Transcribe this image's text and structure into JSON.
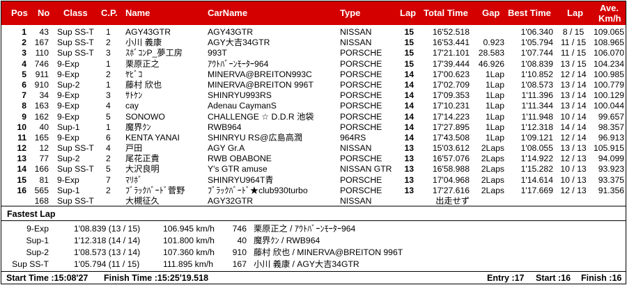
{
  "headers": {
    "pos": "Pos",
    "no": "No",
    "class": "Class",
    "cp": "C.P.",
    "name": "Name",
    "carname": "CarName",
    "type": "Type",
    "lap": "Lap",
    "total_time": "Total Time",
    "gap": "Gap",
    "best_time": "Best Time",
    "best_lap": "Lap",
    "ave_top": "Ave.",
    "ave_bottom": "Km/h"
  },
  "rows": [
    {
      "pos": "1",
      "no": "43",
      "class": "Sup SS-T",
      "cp": "1",
      "name": "AGY43GTR",
      "car": "AGY43GTR",
      "type": "NISSAN",
      "lap": "15",
      "total": "16'52.518",
      "gap": "",
      "best": "1'06.340",
      "blap": "8 / 15",
      "ave": "109.065"
    },
    {
      "pos": "2",
      "no": "167",
      "class": "Sup SS-T",
      "cp": "2",
      "name": "小川 義康",
      "car": "AGY大吉34GTR",
      "type": "NISSAN",
      "lap": "15",
      "total": "16'53.441",
      "gap": "0.923",
      "best": "1'05.794",
      "blap": "11 / 15",
      "ave": "108.965"
    },
    {
      "pos": "3",
      "no": "110",
      "class": "Sup SS-T",
      "cp": "3",
      "name": "ｽﾎﾞｺﾝP_夢工房",
      "car": "993T",
      "type": "PORSCHE",
      "lap": "15",
      "total": "17'21.101",
      "gap": "28.583",
      "best": "1'07.744",
      "blap": "11 / 15",
      "ave": "106.070"
    },
    {
      "pos": "4",
      "no": "746",
      "class": "9-Exp",
      "cp": "1",
      "name": "栗原正之",
      "car": "ｱｳﾄﾊﾞｰﾝﾓｰﾀｰ964",
      "type": "PORSCHE",
      "lap": "15",
      "total": "17'39.444",
      "gap": "46.926",
      "best": "1'08.839",
      "blap": "13 / 15",
      "ave": "104.234"
    },
    {
      "pos": "5",
      "no": "911",
      "class": "9-Exp",
      "cp": "2",
      "name": "ﾔﾋﾞｺ",
      "car": "MINERVA@BREITON993C",
      "type": "PORSCHE",
      "lap": "14",
      "total": "17'00.623",
      "gap": "1Lap",
      "best": "1'10.852",
      "blap": "12 / 14",
      "ave": "100.985"
    },
    {
      "pos": "6",
      "no": "910",
      "class": "Sup-2",
      "cp": "1",
      "name": "藤村 欣也",
      "car": "MINERVA@BREITON 996T",
      "type": "PORSCHE",
      "lap": "14",
      "total": "17'02.709",
      "gap": "1Lap",
      "best": "1'08.573",
      "blap": "13 / 14",
      "ave": "100.779"
    },
    {
      "pos": "7",
      "no": "34",
      "class": "9-Exp",
      "cp": "3",
      "name": "ｻﾄｹﾝ",
      "car": "SHINRYU993RS",
      "type": "PORSCHE",
      "lap": "14",
      "total": "17'09.353",
      "gap": "1Lap",
      "best": "1'11.396",
      "blap": "13 / 14",
      "ave": "100.129"
    },
    {
      "pos": "8",
      "no": "163",
      "class": "9-Exp",
      "cp": "4",
      "name": "cay",
      "car": "Adenau CaymanS",
      "type": "PORSCHE",
      "lap": "14",
      "total": "17'10.231",
      "gap": "1Lap",
      "best": "1'11.344",
      "blap": "13 / 14",
      "ave": "100.044"
    },
    {
      "pos": "9",
      "no": "162",
      "class": "9-Exp",
      "cp": "5",
      "name": "SONOWO",
      "car": "CHALLENGE ☆ D.D.R 池袋",
      "type": "PORSCHE",
      "lap": "14",
      "total": "17'14.223",
      "gap": "1Lap",
      "best": "1'11.948",
      "blap": "10 / 14",
      "ave": "99.657"
    },
    {
      "pos": "10",
      "no": "40",
      "class": "Sup-1",
      "cp": "1",
      "name": "魔界ｸﾝ",
      "car": "RWB964",
      "type": "PORSCHE",
      "lap": "14",
      "total": "17'27.895",
      "gap": "1Lap",
      "best": "1'12.318",
      "blap": "14 / 14",
      "ave": "98.357"
    },
    {
      "pos": "11",
      "no": "165",
      "class": "9-Exp",
      "cp": "6",
      "name": "KENTA YANAI",
      "car": "SHINRYU RS@広島高潤",
      "type": "964RS",
      "lap": "14",
      "total": "17'43.508",
      "gap": "1Lap",
      "best": "1'09.121",
      "blap": "12 / 14",
      "ave": "96.913"
    },
    {
      "pos": "12",
      "no": "12",
      "class": "Sup SS-T",
      "cp": "4",
      "name": "戸田",
      "car": "AGY Gr.A",
      "type": "NISSAN",
      "lap": "13",
      "total": "15'03.612",
      "gap": "2Laps",
      "best": "1'08.055",
      "blap": "13 / 13",
      "ave": "105.915"
    },
    {
      "pos": "13",
      "no": "77",
      "class": "Sup-2",
      "cp": "2",
      "name": "尾花正貴",
      "car": "RWB OBABONE",
      "type": "PORSCHE",
      "lap": "13",
      "total": "16'57.076",
      "gap": "2Laps",
      "best": "1'14.922",
      "blap": "12 / 13",
      "ave": "94.099"
    },
    {
      "pos": "14",
      "no": "166",
      "class": "Sup SS-T",
      "cp": "5",
      "name": "大沢良明",
      "car": "Y's GTR amuse",
      "type": "NISSAN GTR",
      "lap": "13",
      "total": "16'58.988",
      "gap": "2Laps",
      "best": "1'15.282",
      "blap": "10 / 13",
      "ave": "93.923"
    },
    {
      "pos": "15",
      "no": "81",
      "class": "9-Exp",
      "cp": "7",
      "name": "ﾏﾘﾎﾞ",
      "car": "SHINRYU964T青",
      "type": "PORSCHE",
      "lap": "13",
      "total": "17'04.968",
      "gap": "2Laps",
      "best": "1'14.614",
      "blap": "10 / 13",
      "ave": "93.375"
    },
    {
      "pos": "16",
      "no": "565",
      "class": "Sup-1",
      "cp": "2",
      "name": "ﾌﾞﾗｯｸﾊﾞｰﾄﾞ菅野",
      "car": "ﾌﾞﾗｯｸﾊﾞｰﾄﾞ★club930turbo",
      "type": "PORSCHE",
      "lap": "13",
      "total": "17'27.616",
      "gap": "2Laps",
      "best": "1'17.669",
      "blap": "12 / 13",
      "ave": "91.356"
    },
    {
      "pos": "",
      "no": "168",
      "class": "Sup SS-T",
      "cp": "",
      "name": "大槻征久",
      "car": "AGY32GTR",
      "type": "NISSAN",
      "lap": "",
      "total": "出走せず",
      "gap": "",
      "best": "",
      "blap": "",
      "ave": ""
    }
  ],
  "fastest_lap": {
    "title": "Fastest Lap",
    "rows": [
      {
        "class": "9-Exp",
        "time": "1'08.839 (13 / 15)",
        "speed": "106.945 km/h",
        "no": "746",
        "driver": "栗原正之 / ｱｳﾄﾊﾞｰﾝﾓｰﾀｰ964"
      },
      {
        "class": "Sup-1",
        "time": "1'12.318 (14 / 14)",
        "speed": "101.800 km/h",
        "no": "40",
        "driver": "魔界ｸﾝ / RWB964"
      },
      {
        "class": "Sup-2",
        "time": "1'08.573 (13 / 14)",
        "speed": "107.360 km/h",
        "no": "910",
        "driver": "藤村 欣也 / MINERVA@BREITON 996T"
      },
      {
        "class": "Sup SS-T",
        "time": "1'05.794 (11 / 15)",
        "speed": "111.895 km/h",
        "no": "167",
        "driver": "小川 義康 / AGY大吉34GTR"
      }
    ]
  },
  "footer": {
    "start_time": "Start Time :15:08'27",
    "finish_time": "Finish Time :15:25'19.518",
    "entry": "Entry :17",
    "start": "Start :16",
    "finish": "Finish :16"
  },
  "colors": {
    "header_bg": "#d40000",
    "header_text": "#ffffff"
  }
}
